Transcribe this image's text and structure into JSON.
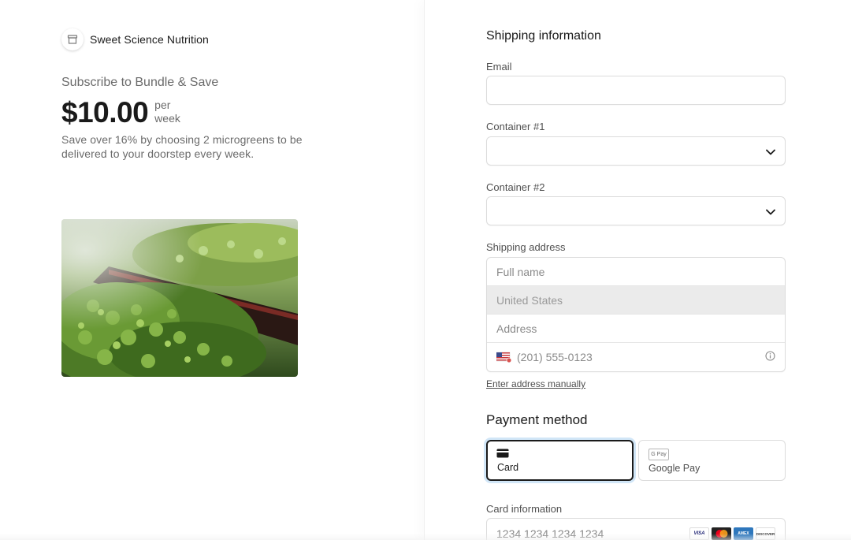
{
  "merchant": {
    "name": "Sweet Science Nutrition"
  },
  "product": {
    "title": "Subscribe to Bundle & Save",
    "price": "$10.00",
    "per_line1": "per",
    "per_line2": "week",
    "description": "Save over 16% by choosing 2 microgreens to be delivered to your doorstep every week."
  },
  "shipping": {
    "title": "Shipping information",
    "email_label": "Email",
    "email_value": "",
    "container1_label": "Container #1",
    "container1_value": "",
    "container2_label": "Container #2",
    "container2_value": "",
    "address_label": "Shipping address",
    "full_name_placeholder": "Full name",
    "country_value": "United States",
    "address_placeholder": "Address",
    "phone_placeholder": "(201) 555-0123",
    "manual_link": "Enter address manually"
  },
  "payment": {
    "title": "Payment method",
    "tabs": [
      {
        "label": "Card",
        "icon": "card-icon",
        "selected": true
      },
      {
        "label": "Google Pay",
        "icon": "google-pay-icon",
        "selected": false
      }
    ],
    "gpay_badge": "G Pay",
    "card_info_label": "Card information",
    "card_number_placeholder": "1234 1234 1234 1234",
    "brands": [
      "VISA",
      "Mastercard",
      "AMEX",
      "DISCOVER"
    ]
  },
  "colors": {
    "text": "#1a1a1a",
    "muted": "#6b6b6b",
    "border": "#dcdcdc",
    "selected_border": "#1a1a1a",
    "focus_ring": "#0074d4"
  }
}
